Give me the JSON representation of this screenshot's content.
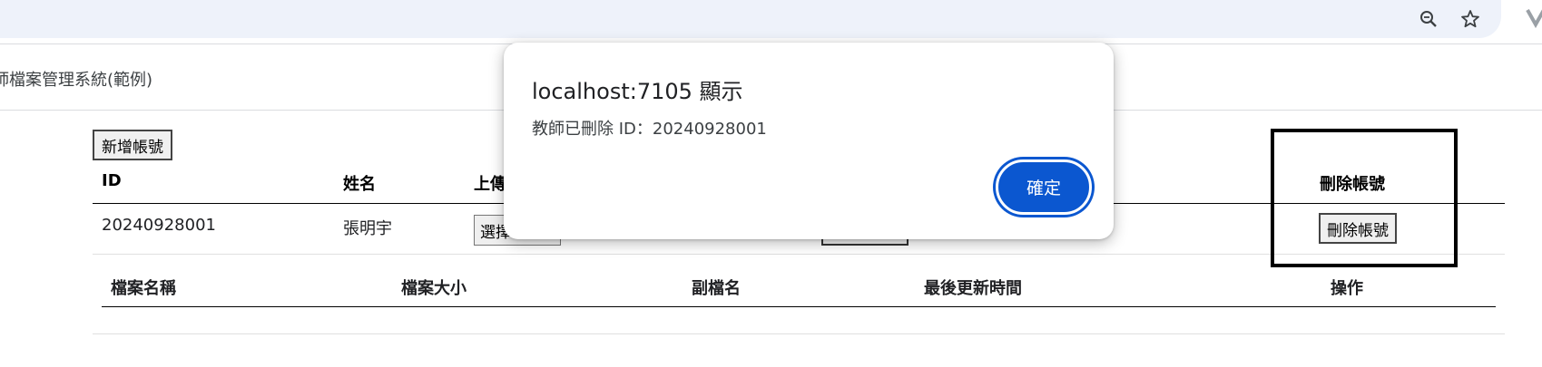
{
  "browser": {
    "icons": [
      "zoom-icon",
      "bookmark-star-icon",
      "extension-icon"
    ]
  },
  "app": {
    "title": "師檔案管理系統(範例)"
  },
  "toolbar": {
    "add_account_label": "新增帳號"
  },
  "teacher_table": {
    "headers": {
      "id": "ID",
      "name": "姓名",
      "upload": "上傳",
      "delete": "刪除帳號"
    },
    "rows": [
      {
        "id": "20240928001",
        "name": "張明宇",
        "file_button_label": "選擇",
        "delete_label": "刪除帳號"
      }
    ]
  },
  "file_table": {
    "headers": {
      "file_name": "檔案名稱",
      "file_size": "檔案大小",
      "extension": "副檔名",
      "last_updated": "最後更新時間",
      "action": "操作"
    }
  },
  "dialog": {
    "origin": "localhost:7105 顯示",
    "message": "教師已刪除 ID：20240928001",
    "ok_label": "確定",
    "accent_color": "#0b57d0"
  }
}
